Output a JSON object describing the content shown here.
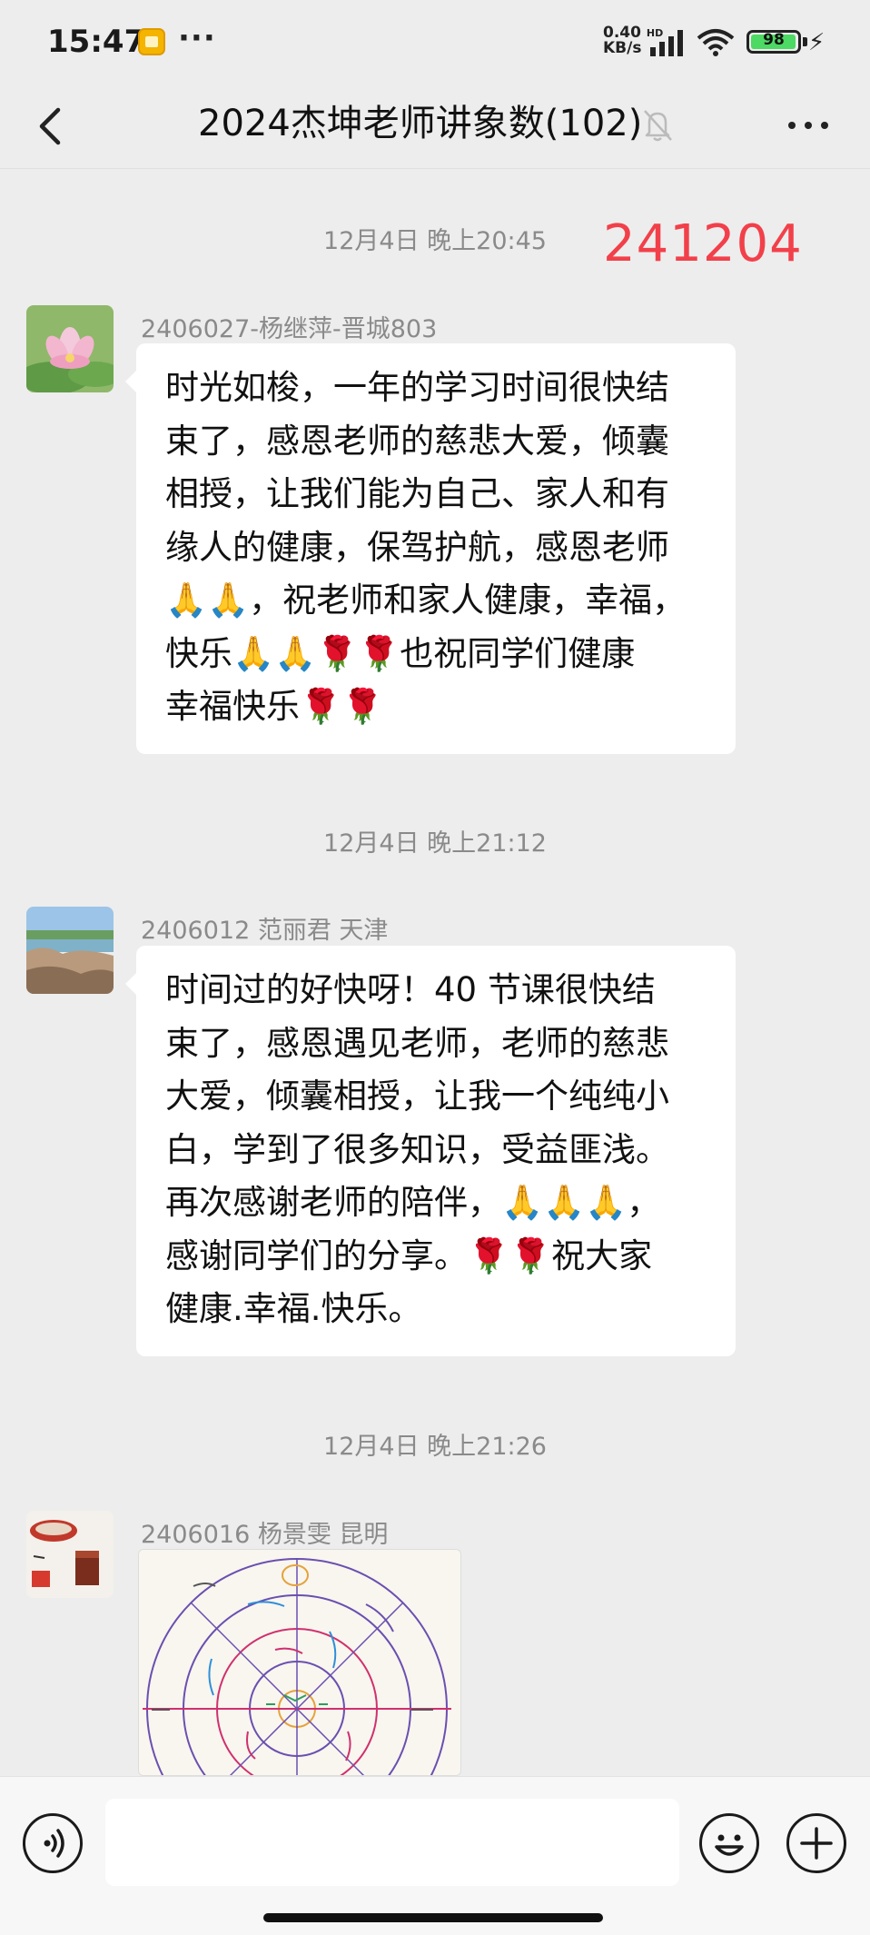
{
  "status_bar": {
    "time": "15:47",
    "dots": "···",
    "net_speed_value": "0.40",
    "net_speed_unit": "KB/s",
    "net_hd": "HD",
    "battery": "98"
  },
  "header": {
    "title": "2024杰坤老师讲象数(102)"
  },
  "overlay_number": "241204",
  "messages": [
    {
      "time": "12月4日 晚上20:45",
      "sender": "2406027-杨继萍-晋城803",
      "lines": [
        "时光如梭，一年的学习时间很快结",
        "束了，感恩老师的慈悲大爱，倾囊",
        "相授，让我们能为自己、家人和有",
        "缘人的健康，保驾护航，感恩老师",
        "🙏🙏，祝老师和家人健康，幸福，",
        "快乐🙏🙏🌹🌹也祝同学们健康",
        "幸福快乐🌹🌹"
      ]
    },
    {
      "time": "12月4日 晚上21:12",
      "sender": "2406012 范丽君 天津",
      "lines": [
        "时间过的好快呀！40 节课很快结",
        "束了，感恩遇见老师，老师的慈悲",
        "大爱，倾囊相授，让我一个纯纯小",
        "白，学到了很多知识，受益匪浅。",
        "再次感谢老师的陪伴，🙏🙏🙏，",
        "感谢同学们的分享。🌹🌹祝大家",
        "健康.幸福.快乐。"
      ]
    },
    {
      "time": "12月4日 晚上21:26",
      "sender": "2406016  杨景雯  昆明"
    }
  ],
  "colors": {
    "background": "#ededed",
    "bubble": "#ffffff",
    "overlay_red": "#f2404a",
    "timestamp": "#8a8a8a"
  },
  "icons": {
    "back": "chevron-left-icon",
    "mute": "bell-off-icon",
    "more": "more-dots-icon",
    "voice": "voice-icon",
    "emoji": "smiley-icon",
    "plus": "plus-icon"
  }
}
